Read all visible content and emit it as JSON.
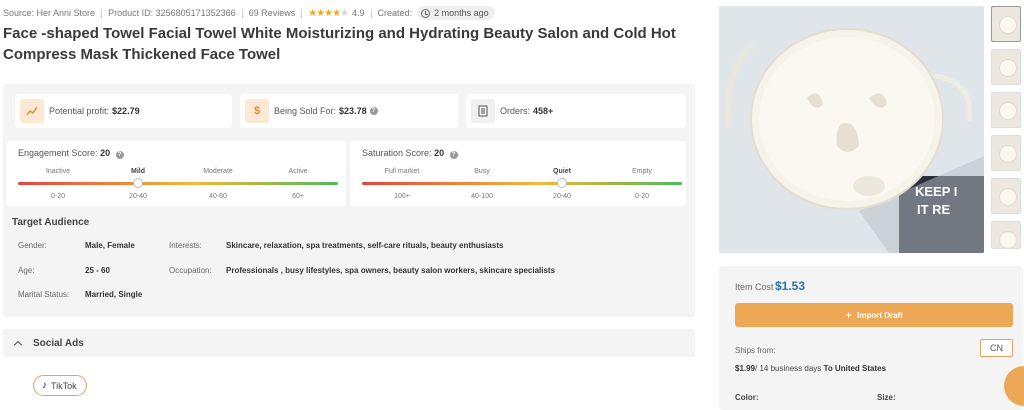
{
  "meta": {
    "source": "Source: Her Anni Store",
    "product_id": "Product ID: 3256805171352366",
    "reviews": "69 Reviews",
    "rating": "4.9",
    "rating_stars": 4,
    "created_label": "Created:",
    "created_value": "2 months ago"
  },
  "title": "Face -shaped Towel Facial Towel White Moisturizing and Hydrating Beauty Salon and Cold Hot Compress Mask Thickened Face Towel",
  "stats": {
    "profit": {
      "label": "Potential profit:",
      "value": "$22.79",
      "icon": "chart-icon"
    },
    "sold_for": {
      "label": "Being Sold For:",
      "value": "$23.78",
      "icon": "dollar-icon"
    },
    "orders": {
      "label": "Orders:",
      "value": "458+",
      "icon": "receipt-icon"
    }
  },
  "engagement": {
    "label": "Engagement Score:",
    "score": "20",
    "levels": [
      "Inactive",
      "Mild",
      "Moderate",
      "Active"
    ],
    "ranges": [
      "0-20",
      "20-40",
      "40-60",
      "60+"
    ],
    "active_index": 1,
    "marker_fraction": 0.375
  },
  "saturation": {
    "label": "Saturation Score:",
    "score": "20",
    "levels": [
      "Full market",
      "Busy",
      "Quiet",
      "Empty"
    ],
    "ranges": [
      "100+",
      "40-100",
      "20-40",
      "0-20"
    ],
    "active_index": 2,
    "marker_fraction": 0.625
  },
  "audience": {
    "title": "Target Audience",
    "gender_label": "Gender:",
    "gender": "Male, Female",
    "age_label": "Age:",
    "age": "25 - 60",
    "marital_label": "Marital Status:",
    "marital": "Married, Single",
    "interests_label": "Interests:",
    "interests": "Skincare, relaxation, spa treatments, self-care rituals, beauty enthusiasts",
    "occupation_label": "Occupation:",
    "occupation": "Professionals , busy lifestyles, spa owners, beauty salon workers, skincare specialists"
  },
  "social": {
    "title": "Social Ads",
    "tiktok": "TikTok"
  },
  "hero_text": "KEEP I\nIT RE",
  "purchase": {
    "item_cost_label": "Item Cost",
    "item_cost": "$1.53",
    "import_label": "Import Draft",
    "ships_from_label": "Ships from:",
    "country": "CN",
    "shipping_price": "$1.99",
    "shipping_days": "/ 14 business days",
    "shipping_dest": "To United States",
    "color_label": "Color:",
    "size_label": "Size:"
  },
  "colors": {
    "accent": "#eda855",
    "price_blue": "#2b6fb6",
    "star": "#f5a623"
  }
}
